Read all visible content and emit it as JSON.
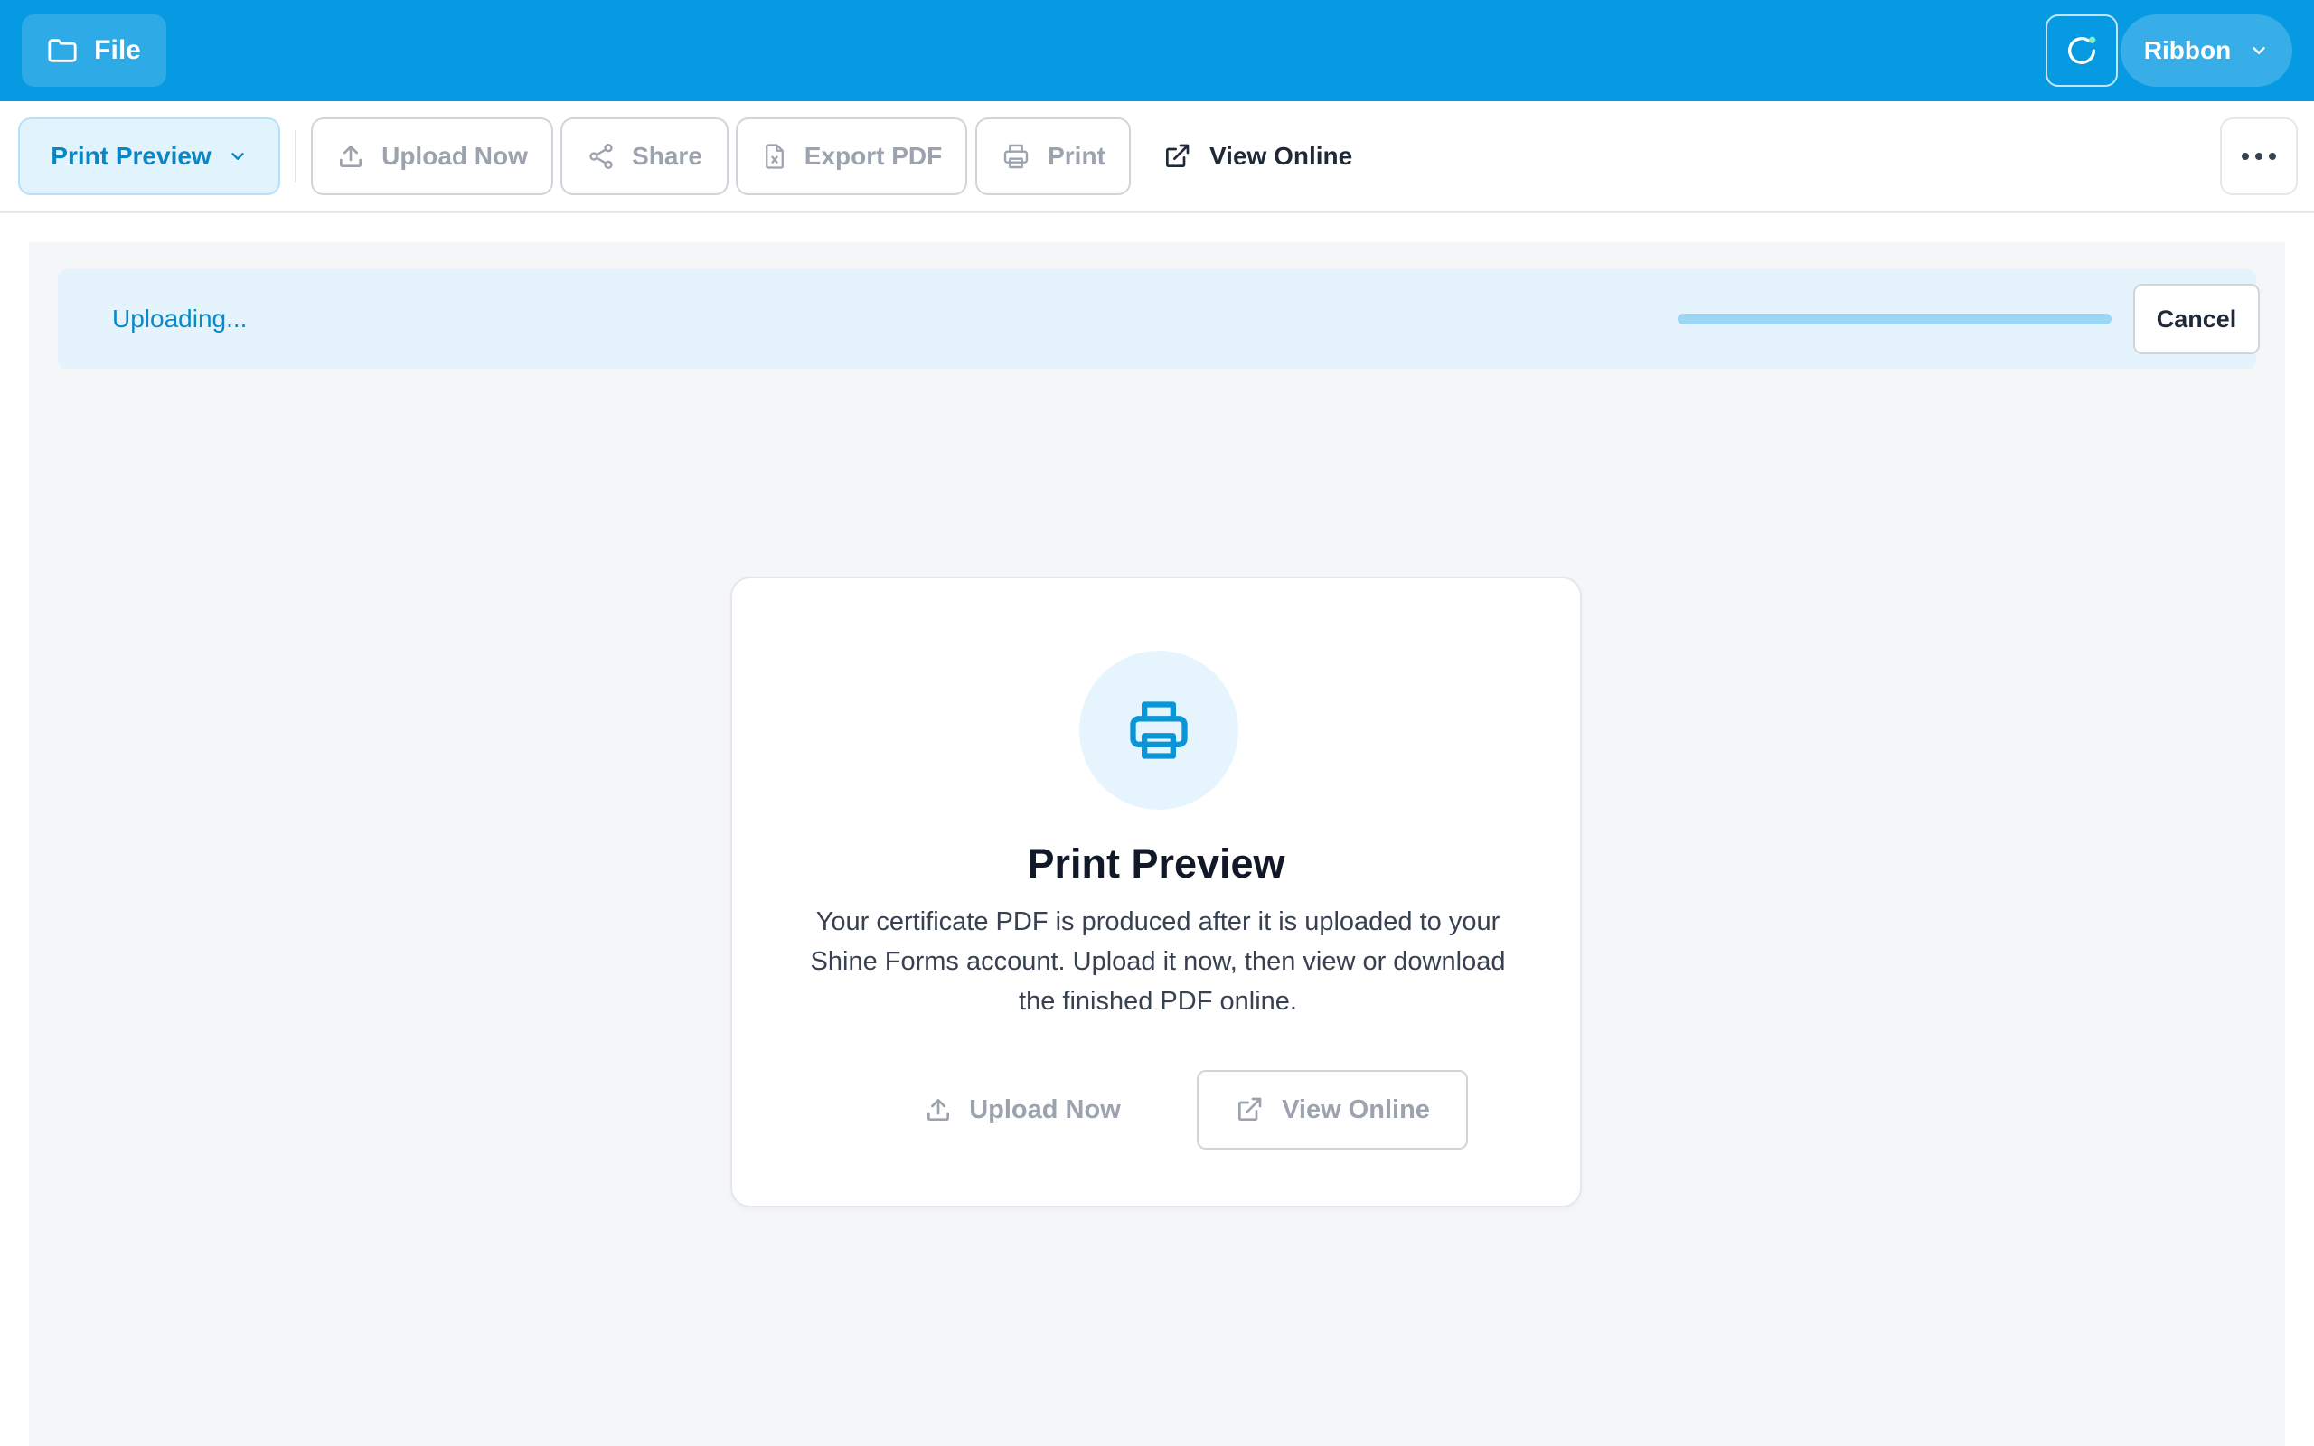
{
  "topbar": {
    "file_label": "File",
    "ribbon_label": "Ribbon",
    "accent_color": "#069ae2"
  },
  "toolbar": {
    "preview_label": "Print Preview",
    "upload_label": "Upload Now",
    "share_label": "Share",
    "export_label": "Export PDF",
    "print_label": "Print",
    "view_online_label": "View Online"
  },
  "upload_banner": {
    "status_text": "Uploading...",
    "progress_fraction": 1.0,
    "cancel_label": "Cancel"
  },
  "card": {
    "title": "Print Preview",
    "description": "Your certificate PDF is produced after it is uploaded to your Shine Forms account. Upload it now, then view or download the finished PDF online.",
    "upload_label": "Upload Now",
    "view_online_label": "View Online"
  },
  "icons": {
    "file": "folder-icon",
    "sync": "refresh-icon",
    "ribbon": "chevron-down-icon",
    "preview": "chevron-down-icon",
    "upload": "upload-icon",
    "share": "share-icon",
    "export": "file-pdf-icon",
    "print": "printer-icon",
    "view_online": "external-link-icon",
    "more": "more-horizontal-icon"
  }
}
